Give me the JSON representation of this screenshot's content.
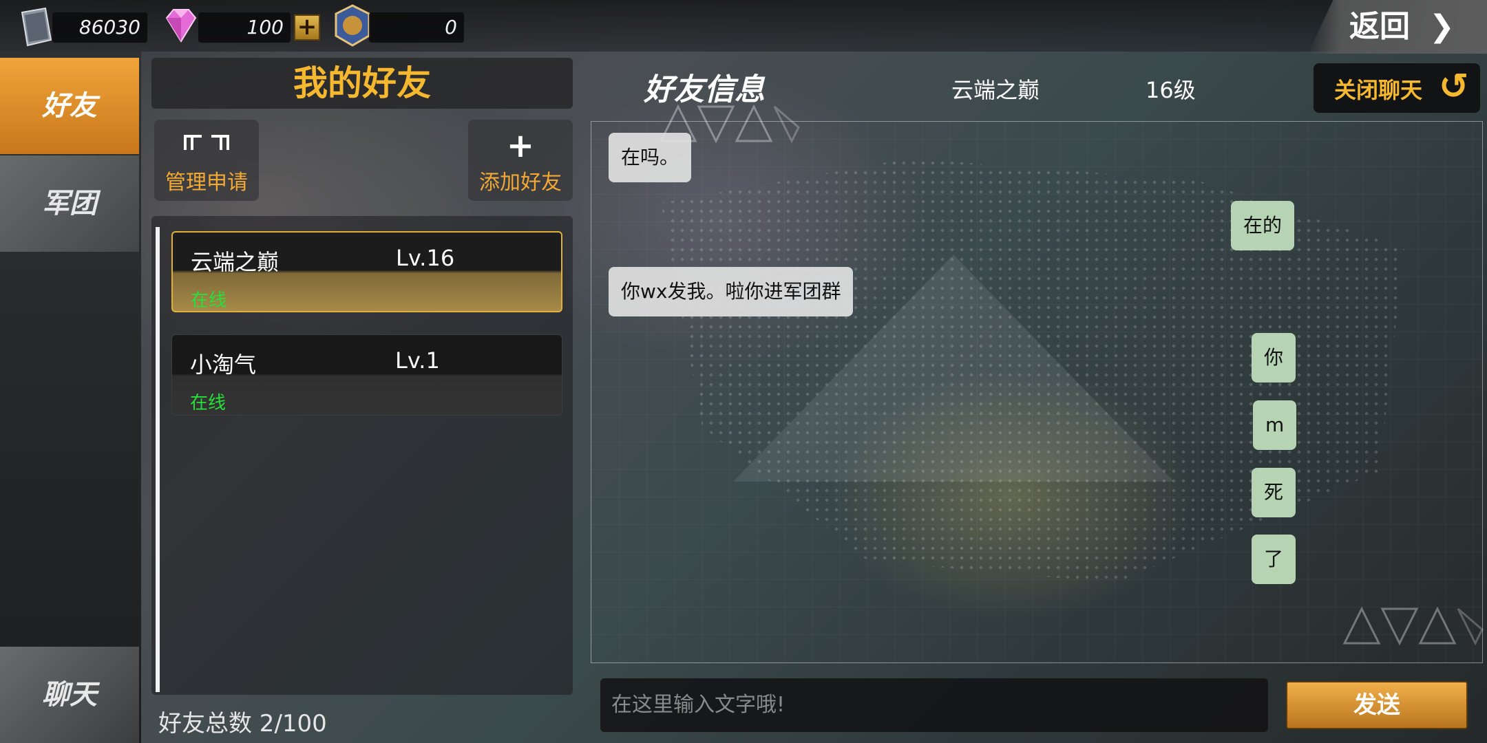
{
  "currency": {
    "silver_value": "86030",
    "gem_value": "100",
    "plus_label": "+",
    "medal_value": "0"
  },
  "back_button": {
    "label": "返回",
    "chevron": "❯"
  },
  "nav": {
    "friends_tab": "好友",
    "legion_tab": "军团",
    "chat_tab": "聊天"
  },
  "friends_panel": {
    "title": "我的好友",
    "manage_label": "管理申请",
    "add_icon": "+",
    "add_label": "添加好友",
    "friends": [
      {
        "name": "云端之巅",
        "level": "Lv.16",
        "status": "在线"
      },
      {
        "name": "小淘气",
        "level": "Lv.1",
        "status": "在线"
      }
    ],
    "count_label": "好友总数 2/100"
  },
  "chat": {
    "header_title": "好友信息",
    "friend_name": "云端之巅",
    "friend_level": "16级",
    "close_label": "关闭聊天",
    "close_icon": "↺",
    "messages": [
      {
        "side": "left",
        "text": "在吗。"
      },
      {
        "side": "right",
        "text": "在的"
      },
      {
        "side": "left",
        "text": "你wx发我。啦你进军团群"
      },
      {
        "side": "right",
        "text": "你"
      },
      {
        "side": "right",
        "text": "m"
      },
      {
        "side": "right",
        "text": "死"
      },
      {
        "side": "right",
        "text": "了"
      }
    ],
    "input_placeholder": "在这里输入文字哦!",
    "send_label": "发送"
  },
  "colors": {
    "accent_orange": "#f0a43a",
    "title_gold": "#f5b82e",
    "online_green": "#27e03a",
    "bubble_right": "#bedcb9",
    "bubble_left": "#e1e1e1"
  },
  "icons": [
    "book-icon",
    "gem-icon",
    "plus-icon",
    "medal-icon",
    "chevron-right-icon",
    "manage-requests-icon",
    "add-friend-icon",
    "close-chat-icon"
  ]
}
